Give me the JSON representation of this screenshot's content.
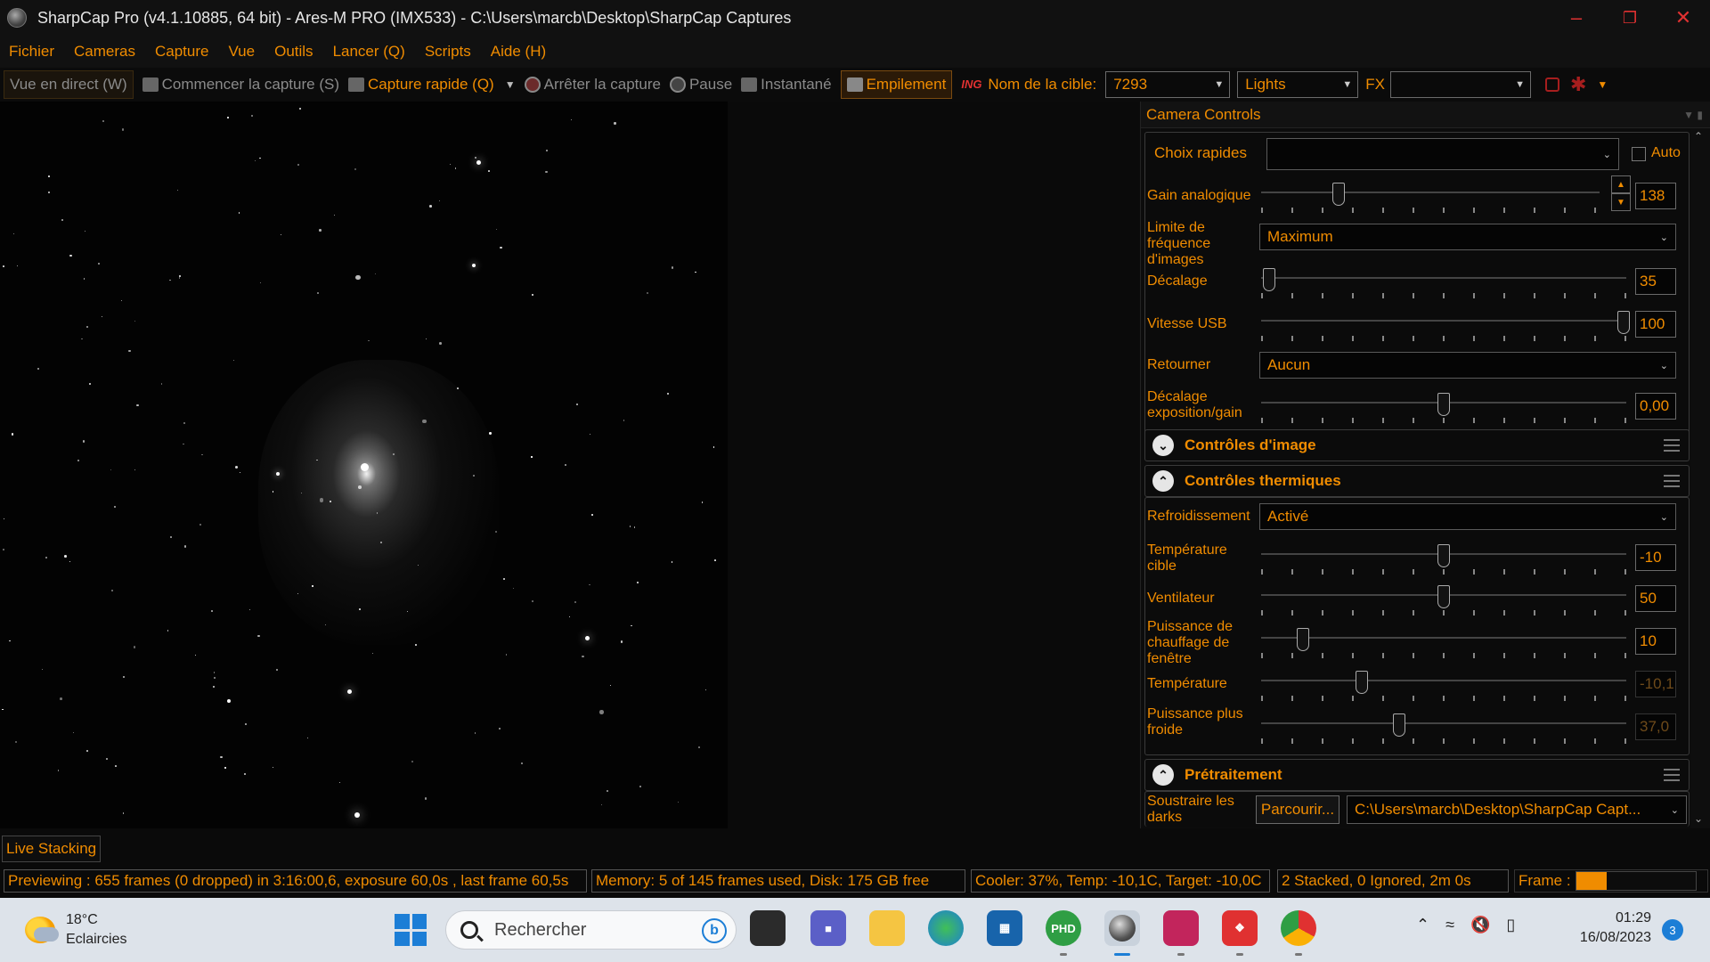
{
  "window": {
    "title": "SharpCap Pro (v4.1.10885, 64 bit) - Ares-M PRO (IMX533) - C:\\Users\\marcb\\Desktop\\SharpCap Captures"
  },
  "menu": [
    "Fichier",
    "Cameras",
    "Capture",
    "Vue",
    "Outils",
    "Lancer (Q)",
    "Scripts",
    "Aide (H)"
  ],
  "toolbar": {
    "live_view": "Vue en direct (W)",
    "start_capture": "Commencer la capture (S)",
    "quick_capture": "Capture rapide (Q)",
    "stop_capture": "Arrêter la capture",
    "pause": "Pause",
    "snapshot": "Instantané",
    "stacking": "Empilement",
    "target_label": "Nom de la cible:",
    "target_value": "7293",
    "frame_type": "Lights",
    "fx_label": "FX",
    "fx_value": ""
  },
  "panel": {
    "title": "Camera Controls",
    "quick_choices_label": "Choix rapides",
    "quick_choices_value": "",
    "auto_label": "Auto",
    "camera_rows": [
      {
        "label": "Gain analogique",
        "value": "138",
        "level": 0.22
      },
      {
        "label": "Limite de fréquence d'images",
        "value": "Maximum"
      },
      {
        "label": "Décalage",
        "value": "35",
        "level": 0.02
      },
      {
        "label": "Vitesse USB",
        "value": "100",
        "level": 1.0
      },
      {
        "label": "Retourner",
        "value": "Aucun"
      },
      {
        "label": "Décalage exposition/gain",
        "value": "0,00",
        "level": 0.5
      }
    ],
    "image_controls_title": "Contrôles d'image",
    "thermal_title": "Contrôles thermiques",
    "thermal_rows": [
      {
        "label": "Refroidissement",
        "value": "Activé"
      },
      {
        "label": "Température cible",
        "value": "-10",
        "level": 0.5
      },
      {
        "label": "Ventilateur",
        "value": "50",
        "level": 0.5
      },
      {
        "label": "Puissance de chauffage de fenêtre",
        "value": "10",
        "level": 0.1
      },
      {
        "label": "Température",
        "value": "-10,1",
        "level": 0.27
      },
      {
        "label": "Puissance plus froide",
        "value": "37,0",
        "level": 0.37
      }
    ],
    "preprocessing_title": "Prétraitement",
    "darks_label": "Soustraire les darks",
    "browse_label": "Parcourir...",
    "darks_path": "C:\\Users\\marcb\\Desktop\\SharpCap Capt..."
  },
  "tabs": {
    "live_stacking": "Live Stacking"
  },
  "status": {
    "preview": "Previewing : 655 frames (0 dropped) in 3:16:00,6, exposure 60,0s , last frame 60,5s",
    "memory": "Memory: 5 of 145 frames used, Disk: 175 GB free",
    "cooler": "Cooler: 37%, Temp: -10,1C, Target: -10,0C",
    "stacked": "2 Stacked, 0 Ignored, 2m 0s",
    "frame_label": "Frame :",
    "frame_progress": 0.25
  },
  "taskbar": {
    "temperature": "18°C",
    "weather": "Eclaircies",
    "search_placeholder": "Rechercher",
    "time": "01:29",
    "date": "16/08/2023",
    "notifications": "3"
  },
  "colors": {
    "accent": "#f08c00",
    "close": "#e03131",
    "windows_blue": "#1c7ed6"
  }
}
